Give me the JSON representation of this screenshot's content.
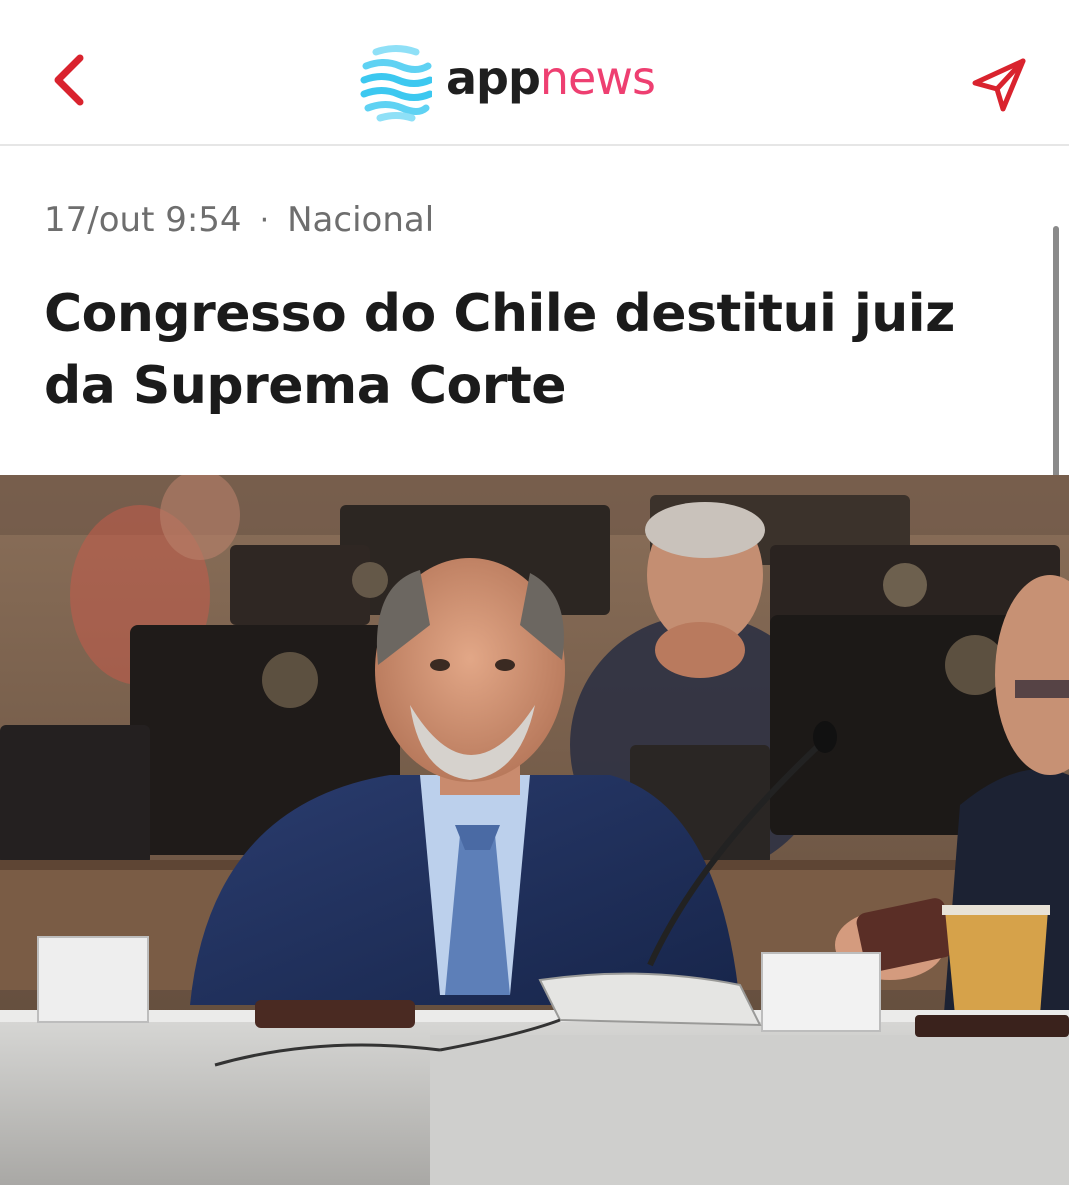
{
  "header": {
    "back_icon": "chevron-left-icon",
    "share_icon": "paper-plane-icon",
    "logo": {
      "part_app": "app",
      "part_news": "news",
      "mark_icon": "wave-logo-icon"
    },
    "colors": {
      "accent_red": "#d9232e",
      "logo_pink": "#ee3f71",
      "logo_blue": "#3cc8f0"
    }
  },
  "article": {
    "date": "17/out 9:54",
    "separator": "·",
    "category": "Nacional",
    "headline": "Congresso do Chile destitui juiz da Suprema Corte"
  }
}
